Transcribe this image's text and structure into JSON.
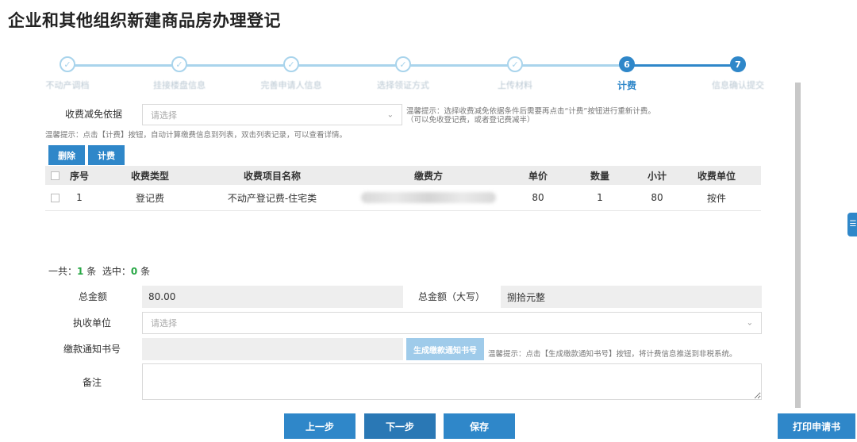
{
  "page_title": "企业和其他组织新建商品房办理登记",
  "steps": [
    {
      "num": "1",
      "label": "不动产调档",
      "state": "done"
    },
    {
      "num": "2",
      "label": "挂接楼盘信息",
      "state": "done"
    },
    {
      "num": "3",
      "label": "完善申请人信息",
      "state": "done"
    },
    {
      "num": "4",
      "label": "选择领证方式",
      "state": "done"
    },
    {
      "num": "5",
      "label": "上传材料",
      "state": "done"
    },
    {
      "num": "6",
      "label": "计费",
      "state": "active"
    },
    {
      "num": "7",
      "label": "信息确认提交",
      "state": "todo"
    }
  ],
  "fee_basis": {
    "label": "收费减免依据",
    "placeholder": "请选择",
    "tip_line1": "温馨提示：选择收费减免依据条件后需要再点击“计费”按钮进行重新计费。",
    "tip_line2": "（可以免收登记费，或者登记费减半）"
  },
  "calc_tip": "温馨提示：点击【计费】按钮，自动计算缴费信息到列表，双击列表记录，可以查看详情。",
  "toolbar": {
    "delete_label": "删除",
    "calc_label": "计费"
  },
  "table": {
    "headers": [
      "序号",
      "收费类型",
      "收费项目名称",
      "缴费方",
      "单价",
      "数量",
      "小计",
      "收费单位"
    ],
    "rows": [
      {
        "index": "1",
        "fee_type": "登记费",
        "item_name": "不动产登记费-住宅类",
        "payer": "",
        "price": "80",
        "qty": "1",
        "subtotal": "80",
        "unit": "按件"
      }
    ]
  },
  "summary": {
    "total_prefix": "一共：",
    "total_count": "1",
    "total_suffix": "条",
    "selected_prefix": "选中：",
    "selected_count": "0",
    "selected_suffix": "条"
  },
  "form": {
    "total_label": "总金额",
    "total_value": "80.00",
    "total_upper_label": "总金额（大写）",
    "total_upper_value": "捌拾元整",
    "collector_label": "执收单位",
    "collector_placeholder": "请选择",
    "notice_label": "缴款通知书号",
    "notice_value": "",
    "gen_notice_label": "生成缴款通知书号",
    "notice_tip": "温馨提示：点击【生成缴款通知书号】按钮，将计费信息推送到非税系统。",
    "remark_label": "备注",
    "remark_value": ""
  },
  "footer": {
    "prev_label": "上一步",
    "next_label": "下一步",
    "save_label": "保存",
    "print_label": "打印申请书"
  },
  "colors": {
    "primary": "#2f87c9",
    "done_step": "#a9d4ec",
    "count_green": "#28a745"
  }
}
